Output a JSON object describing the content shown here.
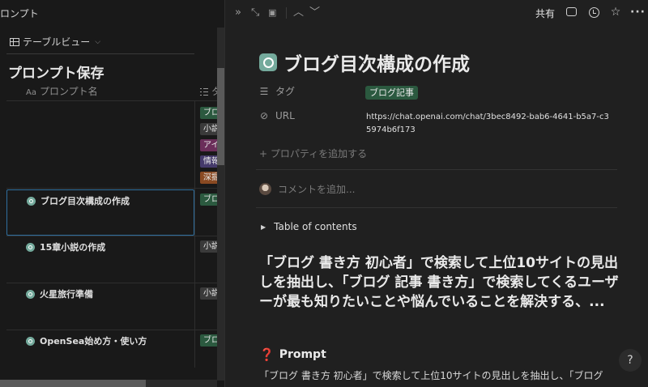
{
  "left": {
    "breadcrumb": "ロンプト",
    "view_tab": "テーブルビュー",
    "db_title": "プロンプト保存",
    "col_name_icon": "Aa",
    "col_name": "プロンプト名",
    "col_tags": "タ",
    "top_tags": [
      {
        "label": "ブロ",
        "color": "#2b593f"
      },
      {
        "label": "小説",
        "color": "#3a3a3a"
      },
      {
        "label": "アイ",
        "color": "#6b2e5a"
      },
      {
        "label": "情報",
        "color": "#453a6b"
      },
      {
        "label": "深掘",
        "color": "#8a4a22"
      }
    ],
    "rows": [
      {
        "name": "ブログ目次構成の作成",
        "tag": "ブロ",
        "tag_color": "#2b593f"
      },
      {
        "name": "15章小説の作成",
        "tag": "小説",
        "tag_color": "#3a3a3a"
      },
      {
        "name": "火星旅行準備",
        "tag": "小説",
        "tag_color": "#3a3a3a"
      },
      {
        "name": "OpenSea始め方・使い方",
        "tag": "ブロ",
        "tag_color": "#2b593f"
      }
    ]
  },
  "right": {
    "share_label": "共有",
    "title": "ブログ目次構成の作成",
    "props": {
      "tag_label": "タグ",
      "tag_value": "ブログ記事",
      "url_label": "URL",
      "url_value": "https://chat.openai.com/chat/3bec8492-bab6-4641-b5a7-c35974b6f173",
      "add_property": "プロパティを追加する"
    },
    "comment_placeholder": "コメントを追加...",
    "toc_label": "Table of contents",
    "heading": "「ブログ 書き方 初心者」で検索して上位10サイトの見出しを抽出し、「ブログ 記事 書き方」で検索してくるユーザーが最も知りたいことや悩んでいることを解決する、...",
    "prompt_heading": "Prompt",
    "body_text": "「ブログ 書き方 初心者」で検索して上位10サイトの見出しを抽出し、「ブログ",
    "help_label": "?"
  },
  "icons": {
    "double-chevron": "»",
    "expand": "⤡",
    "side-peek": "▣",
    "up": "︿",
    "down": "﹀",
    "star": "☆",
    "plus": "+",
    "link": "⊘",
    "triangle": "▶",
    "question": "❓"
  },
  "colors": {
    "accent_select": "#2f6f9f",
    "tag_green": "#2b593f"
  }
}
